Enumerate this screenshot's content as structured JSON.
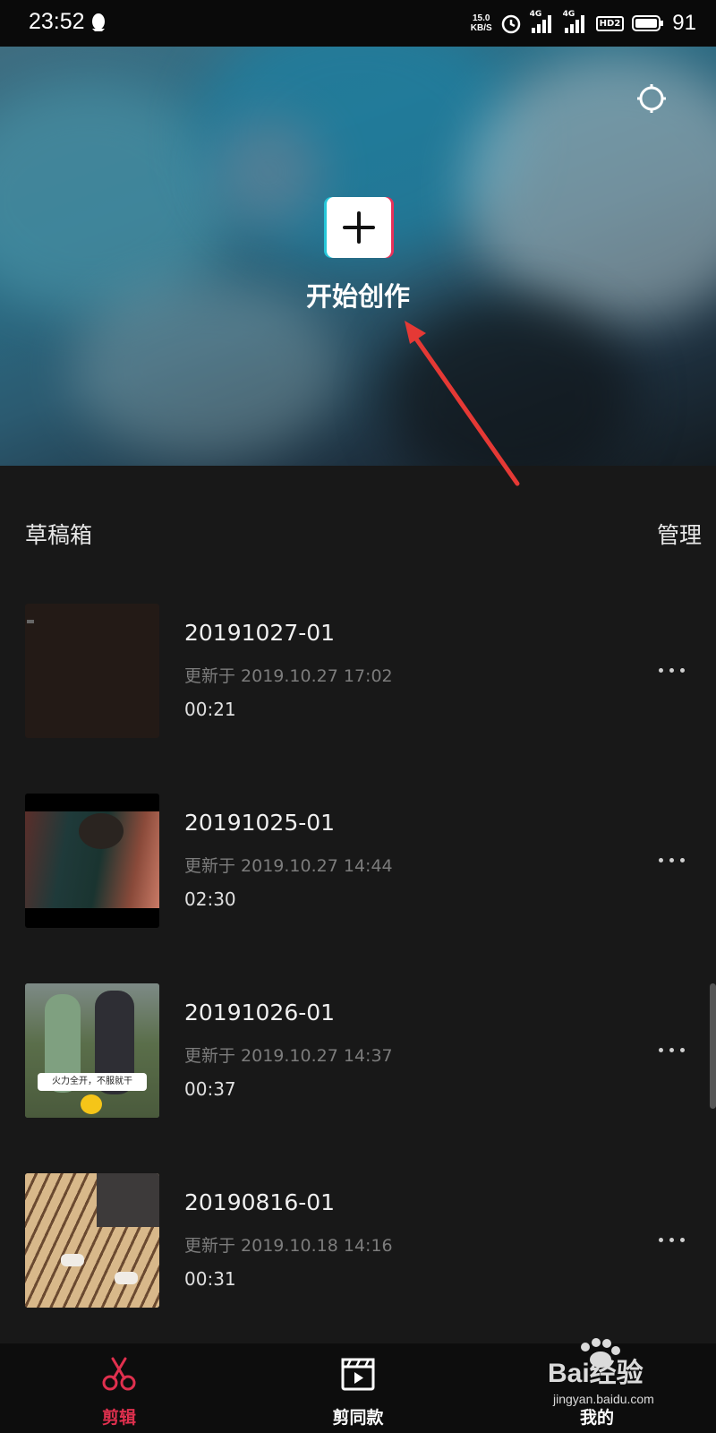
{
  "status_bar": {
    "time": "23:52",
    "speed_value": "15.0",
    "speed_unit": "KB/S",
    "network_1": "4G",
    "network_2": "4G",
    "hd": "HD2",
    "battery": "91"
  },
  "hero": {
    "create_label": "开始创作",
    "settings_icon": "settings-gear-icon",
    "create_icon": "plus-icon"
  },
  "drafts": {
    "title": "草稿箱",
    "manage_label": "管理",
    "items": [
      {
        "name": "20191027-01",
        "updated": "更新于 2019.10.27 17:02",
        "duration": "00:21"
      },
      {
        "name": "20191025-01",
        "updated": "更新于 2019.10.27 14:44",
        "duration": "02:30"
      },
      {
        "name": "20191026-01",
        "updated": "更新于 2019.10.27 14:37",
        "duration": "00:37",
        "caption": "火力全开，不服就干"
      },
      {
        "name": "20190816-01",
        "updated": "更新于 2019.10.18 14:16",
        "duration": "00:31"
      }
    ]
  },
  "bottom_nav": {
    "items": [
      {
        "label": "剪辑",
        "icon": "scissors-icon",
        "active": true
      },
      {
        "label": "剪同款",
        "icon": "clapperboard-play-icon",
        "active": false
      },
      {
        "label": "我的",
        "icon": "profile-icon",
        "active": false
      }
    ],
    "active_color": "#e0304e"
  },
  "watermark": {
    "main": "Bai经验",
    "sub": "jingyan.baidu.com"
  },
  "colors": {
    "background": "#181818",
    "accent": "#e0304e",
    "annotation_arrow": "#e53935"
  }
}
